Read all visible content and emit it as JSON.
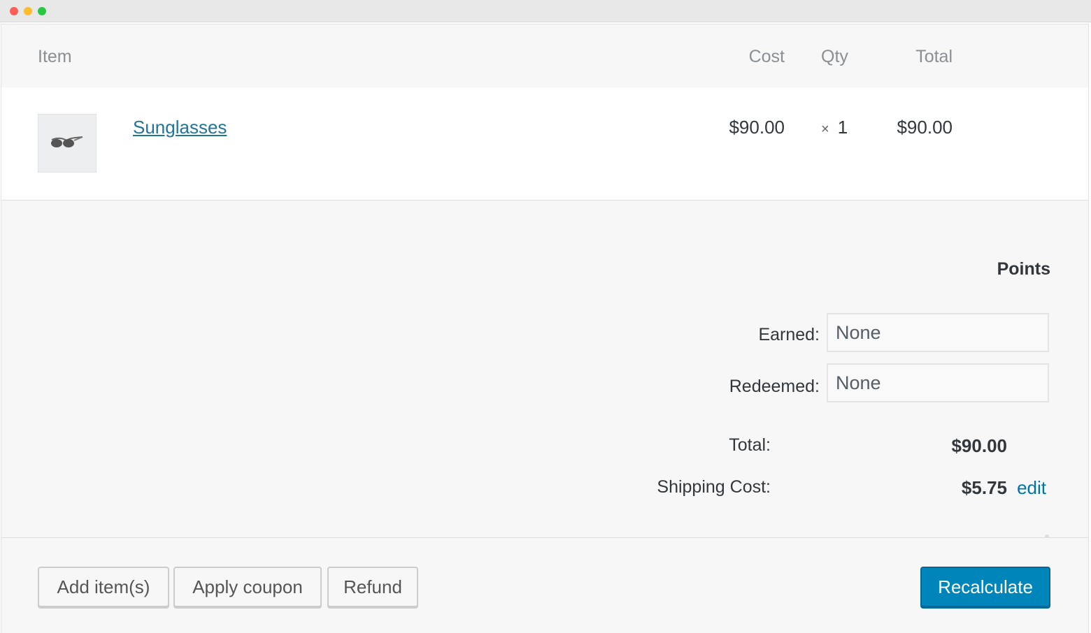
{
  "window": {
    "controls": [
      "close",
      "minimize",
      "zoom"
    ]
  },
  "table": {
    "headers": {
      "item": "Item",
      "cost": "Cost",
      "qty": "Qty",
      "total": "Total"
    },
    "rows": [
      {
        "product_name": "Sunglasses",
        "thumbnail_icon": "sunglasses-icon",
        "cost": "$90.00",
        "qty_symbol": "×",
        "qty": "1",
        "total": "$90.00"
      }
    ]
  },
  "points": {
    "heading": "Points",
    "earned_label": "Earned:",
    "earned_value": "None",
    "redeemed_label": "Redeemed:",
    "redeemed_value": "None"
  },
  "totals": {
    "total_label": "Total:",
    "total_value": "$90.00",
    "shipping_label": "Shipping Cost:",
    "shipping_value": "$5.75",
    "edit_label": "edit"
  },
  "actions": {
    "add_items": "Add item(s)",
    "apply_coupon": "Apply coupon",
    "refund": "Refund",
    "recalculate": "Recalculate"
  },
  "colors": {
    "link": "#21759b",
    "primary_button": "#0085ba",
    "background": "#f7f7f7"
  }
}
